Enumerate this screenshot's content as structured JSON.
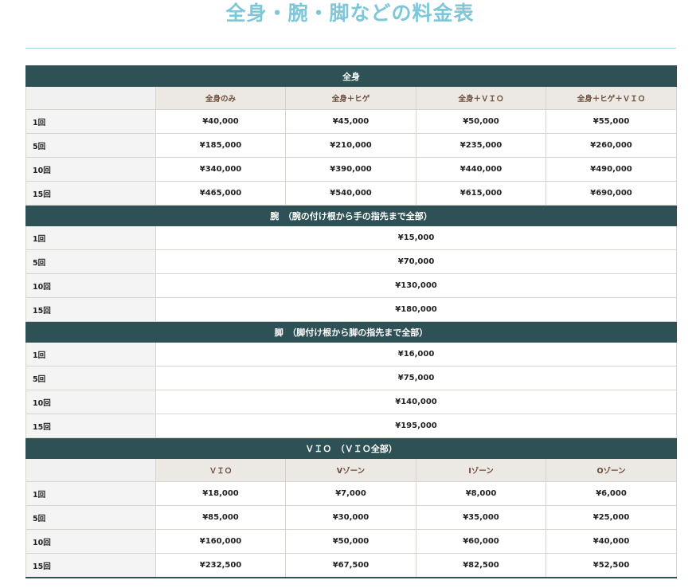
{
  "page": {
    "title": "全身・腕・脚などの料金表"
  },
  "sections": [
    {
      "title": "全身",
      "columns": [
        "全身のみ",
        "全身＋ヒゲ",
        "全身＋ＶＩＯ",
        "全身＋ヒゲ＋ＶＩＯ"
      ],
      "rows": [
        {
          "label": "1回",
          "values": [
            "¥40,000",
            "¥45,000",
            "¥50,000",
            "¥55,000"
          ]
        },
        {
          "label": "5回",
          "values": [
            "¥185,000",
            "¥210,000",
            "¥235,000",
            "¥260,000"
          ]
        },
        {
          "label": "10回",
          "values": [
            "¥340,000",
            "¥390,000",
            "¥440,000",
            "¥490,000"
          ]
        },
        {
          "label": "15回",
          "values": [
            "¥465,000",
            "¥540,000",
            "¥615,000",
            "¥690,000"
          ]
        }
      ]
    },
    {
      "title": "腕　（腕の付け根から手の指先まで全部）",
      "rows": [
        {
          "label": "1回",
          "value": "¥15,000"
        },
        {
          "label": "5回",
          "value": "¥70,000"
        },
        {
          "label": "10回",
          "value": "¥130,000"
        },
        {
          "label": "15回",
          "value": "¥180,000"
        }
      ]
    },
    {
      "title": "脚　（脚付け根から脚の指先まで全部）",
      "rows": [
        {
          "label": "1回",
          "value": "¥16,000"
        },
        {
          "label": "5回",
          "value": "¥75,000"
        },
        {
          "label": "10回",
          "value": "¥140,000"
        },
        {
          "label": "15回",
          "value": "¥195,000"
        }
      ]
    },
    {
      "title": "ＶＩＯ　（ＶＩＯ全部）",
      "columns": [
        "ＶＩＯ",
        "Vゾーン",
        "Iゾーン",
        "Oゾーン"
      ],
      "rows": [
        {
          "label": "1回",
          "values": [
            "¥18,000",
            "¥7,000",
            "¥8,000",
            "¥6,000"
          ]
        },
        {
          "label": "5回",
          "values": [
            "¥85,000",
            "¥30,000",
            "¥35,000",
            "¥25,000"
          ]
        },
        {
          "label": "10回",
          "values": [
            "¥160,000",
            "¥50,000",
            "¥60,000",
            "¥40,000"
          ]
        },
        {
          "label": "15回",
          "values": [
            "¥232,500",
            "¥67,500",
            "¥82,500",
            "¥52,500"
          ]
        }
      ]
    }
  ]
}
